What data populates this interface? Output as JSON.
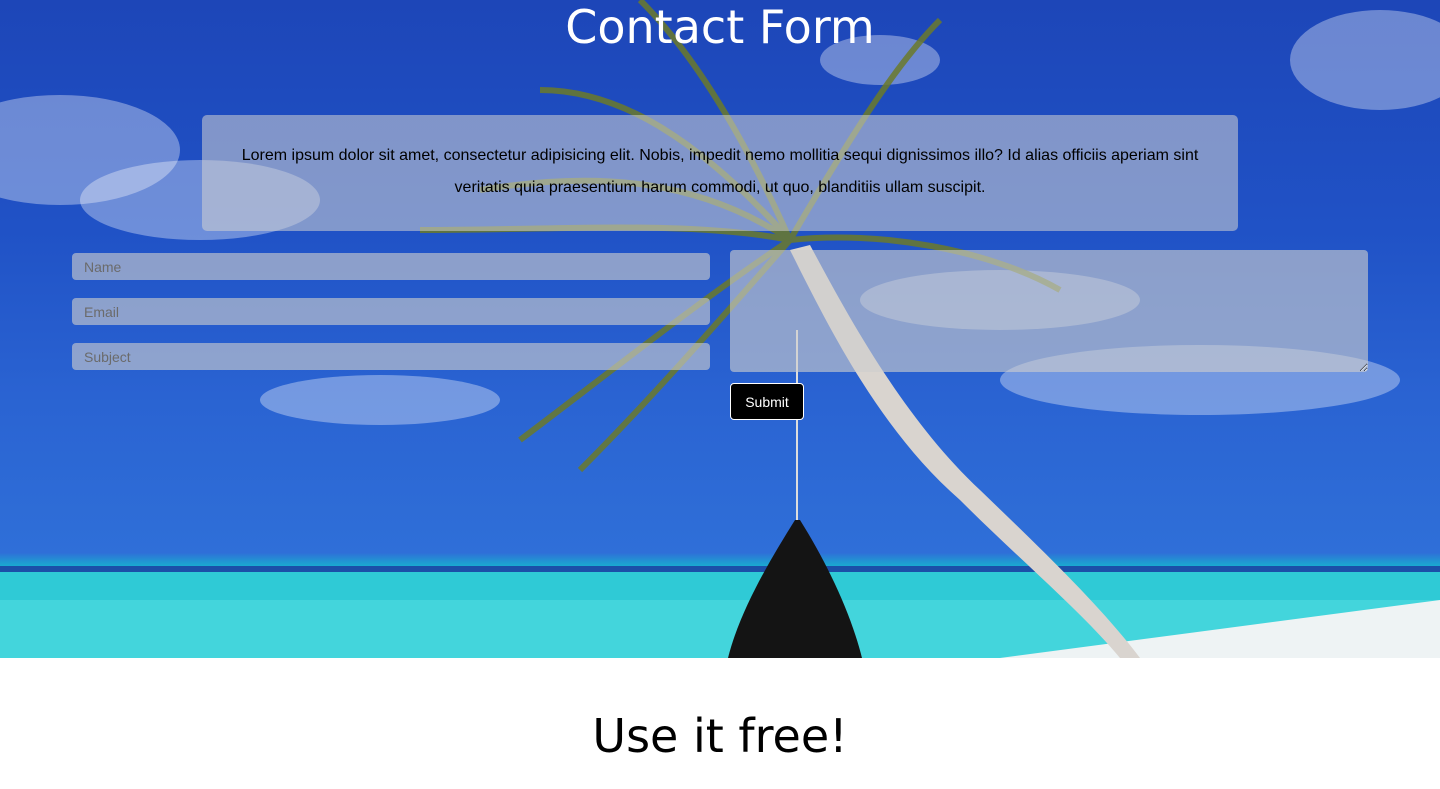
{
  "hero": {
    "title": "Contact Form",
    "intro_text": "Lorem ipsum dolor sit amet, consectetur adipisicing elit. Nobis, impedit nemo mollitia sequi dignissimos illo? Id alias officiis aperiam sint veritatis quia praesentium harum commodi, ut quo, blanditiis ullam suscipit."
  },
  "form": {
    "name_placeholder": "Name",
    "email_placeholder": "Email",
    "subject_placeholder": "Subject",
    "message_placeholder": "",
    "submit_label": "Submit"
  },
  "footer": {
    "title": "Use it free!"
  },
  "background": {
    "description_icon": "beach-palm-hammock-photo"
  }
}
